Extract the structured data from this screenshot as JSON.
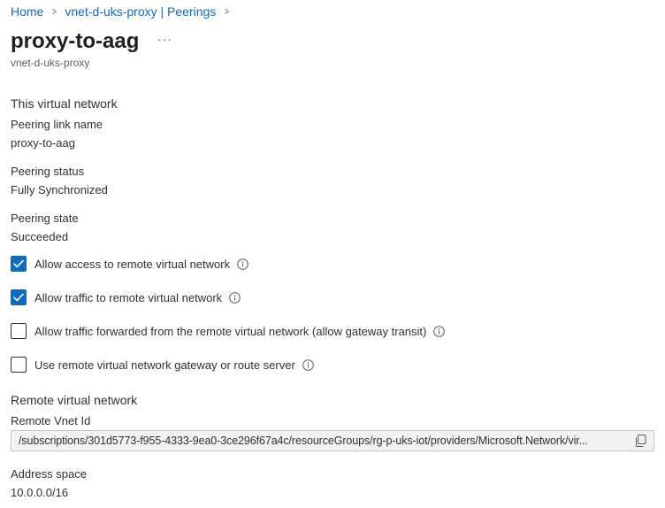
{
  "breadcrumb": {
    "home": "Home",
    "parent": "vnet-d-uks-proxy | Peerings",
    "separator": ">"
  },
  "header": {
    "title": "proxy-to-aag",
    "more": "···",
    "subtitle": "vnet-d-uks-proxy"
  },
  "this_network": {
    "heading": "This virtual network",
    "link_name_label": "Peering link name",
    "link_name_value": "proxy-to-aag",
    "status_label": "Peering status",
    "status_value": "Fully Synchronized",
    "state_label": "Peering state",
    "state_value": "Succeeded"
  },
  "options": [
    {
      "label": "Allow access to remote virtual network",
      "checked": true
    },
    {
      "label": "Allow traffic to remote virtual network",
      "checked": true
    },
    {
      "label": "Allow traffic forwarded from the remote virtual network (allow gateway transit)",
      "checked": false
    },
    {
      "label": "Use remote virtual network gateway or route server",
      "checked": false
    }
  ],
  "remote_network": {
    "heading": "Remote virtual network",
    "vnet_id_label": "Remote Vnet Id",
    "vnet_id_value": "/subscriptions/301d5773-f955-4333-9ea0-3ce296f67a4c/resourceGroups/rg-p-uks-iot/providers/Microsoft.Network/vir...",
    "address_space_label": "Address space",
    "address_space_value": "10.0.0.0/16"
  },
  "icons": {
    "info": "info-icon",
    "copy": "copy-icon",
    "check": "checkmark-icon",
    "chevron": "chevron-right-icon"
  },
  "colors": {
    "link": "#0f6cbd",
    "checkbox_checked": "#0f6cbd",
    "text": "#323130",
    "muted": "#605e5c",
    "readonly_field_bg": "#f3f2f1"
  }
}
